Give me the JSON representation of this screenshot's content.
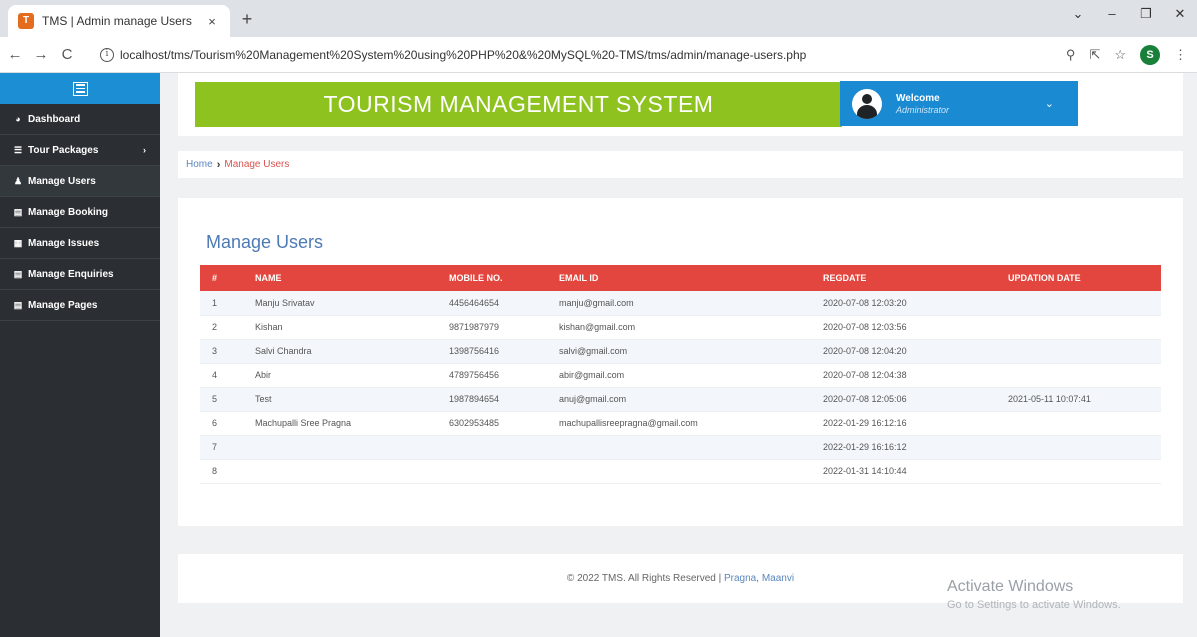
{
  "browser": {
    "tab_title": "TMS | Admin manage Users",
    "tab_close": "×",
    "new_tab": "+",
    "favicon": "🗺",
    "url": "localhost/tms/Tourism%20Management%20System%20using%20PHP%20&%20MySQL%20-TMS/tms/admin/manage-users.php",
    "profile_initial": "S",
    "controls": {
      "chevron": "⌄",
      "minimize": "–",
      "maximize": "❐",
      "close": "✕"
    },
    "nav": {
      "back": "←",
      "forward": "→",
      "reload": "C"
    },
    "icons": {
      "zoom": "🔍",
      "share": "⇱",
      "star": "☆",
      "menu": "⋮",
      "info": "i"
    }
  },
  "sidebar": {
    "items": [
      {
        "label": "Dashboard",
        "icon": "dashboard-icon",
        "glyph": "◕"
      },
      {
        "label": "Tour Packages",
        "icon": "list-icon",
        "glyph": "☰",
        "arrow": "›"
      },
      {
        "label": "Manage Users",
        "icon": "users-icon",
        "glyph": "👥"
      },
      {
        "label": "Manage Booking",
        "icon": "table-icon",
        "glyph": "▤"
      },
      {
        "label": "Manage Issues",
        "icon": "grid-icon",
        "glyph": "▦"
      },
      {
        "label": "Manage Enquiries",
        "icon": "file-icon",
        "glyph": "🗎"
      },
      {
        "label": "Manage Pages",
        "icon": "file-icon",
        "glyph": "🗎"
      }
    ]
  },
  "header": {
    "brand": "TOURISM MANAGEMENT SYSTEM",
    "welcome_title": "Welcome",
    "welcome_role": "Administrator",
    "chevron": "⌄"
  },
  "breadcrumb": {
    "home": "Home",
    "separator": "›",
    "current": "Manage Users"
  },
  "panel": {
    "title": "Manage Users",
    "columns": [
      "#",
      "NAME",
      "MOBILE NO.",
      "EMAIL ID",
      "REGDATE",
      "UPDATION DATE"
    ],
    "rows": [
      [
        "1",
        "Manju Srivatav",
        "4456464654",
        "manju@gmail.com",
        "2020-07-08 12:03:20",
        ""
      ],
      [
        "2",
        "Kishan",
        "9871987979",
        "kishan@gmail.com",
        "2020-07-08 12:03:56",
        ""
      ],
      [
        "3",
        "Salvi Chandra",
        "1398756416",
        "salvi@gmail.com",
        "2020-07-08 12:04:20",
        ""
      ],
      [
        "4",
        "Abir",
        "4789756456",
        "abir@gmail.com",
        "2020-07-08 12:04:38",
        ""
      ],
      [
        "5",
        "Test",
        "1987894654",
        "anuj@gmail.com",
        "2020-07-08 12:05:06",
        "2021-05-11 10:07:41"
      ],
      [
        "6",
        "Machupalli Sree Pragna",
        "6302953485",
        "machupallisreepragna@gmail.com",
        "2022-01-29 16:12:16",
        ""
      ],
      [
        "7",
        "",
        "",
        "",
        "2022-01-29 16:16:12",
        ""
      ],
      [
        "8",
        "",
        "",
        "",
        "2022-01-31 14:10:44",
        ""
      ]
    ]
  },
  "footer": {
    "text": "© 2022 TMS. All Rights Reserved |",
    "link1": "Pragna",
    "sep": ",",
    "link2": "Maanvi"
  },
  "watermark": {
    "title": "Activate Windows",
    "subtitle": "Go to Settings to activate Windows."
  }
}
